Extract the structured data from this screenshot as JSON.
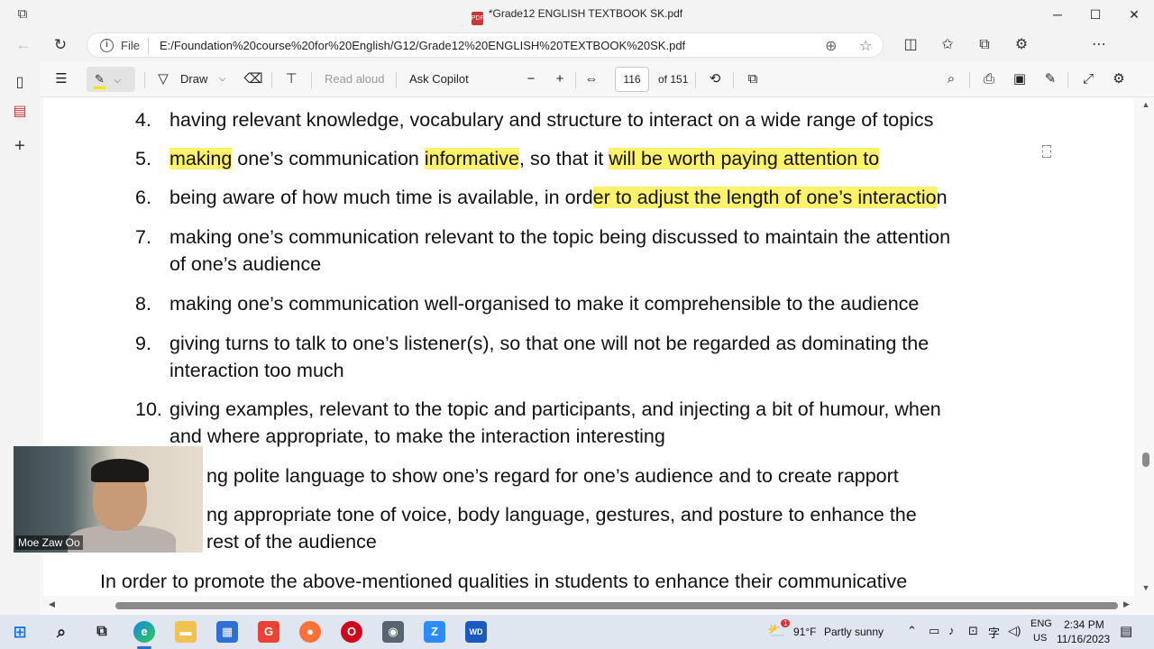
{
  "window": {
    "title": "*Grade12 ENGLISH TEXTBOOK SK.pdf",
    "file_badge": "PDF",
    "minimize": "─",
    "maximize": "☐",
    "close": "✕"
  },
  "address_bar": {
    "scheme_label": "File",
    "url": "E:/Foundation%20course%20for%20English/G12/Grade12%20ENGLISH%20TEXTBOOK%20SK.pdf"
  },
  "pdf_toolbar": {
    "draw_label": "Draw",
    "read_aloud_label": "Read aloud",
    "ask_copilot_label": "Ask Copilot",
    "zoom_out": "−",
    "zoom_in": "+",
    "page_current": "116",
    "page_total": "of 151"
  },
  "document": {
    "lines": [
      {
        "num": "4.",
        "segments": [
          {
            "text": "having relevant knowledge, vocabulary and structure to interact on a wide range of topics",
            "hl": false
          }
        ]
      },
      {
        "num": "5.",
        "segments": [
          {
            "text": "making",
            "hl": true
          },
          {
            "text": " one’s communication ",
            "hl": false
          },
          {
            "text": "informative",
            "hl": true
          },
          {
            "text": ", so that it ",
            "hl": false
          },
          {
            "text": "will be worth paying attention to",
            "hl": true
          }
        ]
      },
      {
        "num": "6.",
        "segments": [
          {
            "text": "being aware of how much time is available, in ord",
            "hl": false
          },
          {
            "text": "er to adjust the length of one’s interactio",
            "hl": true
          },
          {
            "text": "n",
            "hl": false
          }
        ]
      },
      {
        "num": "7.",
        "segments": [
          {
            "text": "making one’s communication relevant to the topic being discussed to maintain the attention",
            "hl": false
          }
        ],
        "cont": "of one’s audience"
      },
      {
        "num": "8.",
        "segments": [
          {
            "text": "making one’s communication well-organised to make it comprehensible to the audience",
            "hl": false
          }
        ]
      },
      {
        "num": "9.",
        "segments": [
          {
            "text": "giving turns to talk to one’s listener(s), so that one will not be regarded as dominating the",
            "hl": false
          }
        ],
        "cont": "interaction too much"
      },
      {
        "num": "10.",
        "segments": [
          {
            "text": "giving examples, relevant to the topic and participants, and injecting a bit of humour, when",
            "hl": false
          }
        ],
        "cont": "and where appropriate, to make the interaction interesting"
      },
      {
        "num": "",
        "segments": [
          {
            "text": "ng polite language to show one’s regard for one’s audience and to create rapport",
            "hl": false
          }
        ]
      },
      {
        "num": "",
        "segments": [
          {
            "text": "ng appropriate tone of voice, body language, gestures, and posture to enhance the",
            "hl": false
          }
        ],
        "cont": "rest of the audience"
      }
    ],
    "paragraph": "In order to promote the above-mentioned qualities in students to enhance their communicative"
  },
  "webcam": {
    "name": "Moe Zaw Oo"
  },
  "taskbar": {
    "weather_temp": "91°F",
    "weather_desc": "Partly sunny",
    "lang_top": "ENG",
    "lang_bottom": "US",
    "time": "2:34 PM",
    "date": "11/16/2023",
    "weather_badge": "1"
  },
  "colors": {
    "highlight": "#fff26b",
    "pdf_red": "#d13438",
    "scrollbar": "#8a8a8a"
  },
  "icons": [
    "edge-workspaces-icon",
    "back-icon",
    "refresh-icon",
    "info-icon",
    "zoom-icon",
    "star-icon",
    "split-screen-icon",
    "favorites-icon",
    "collections-icon",
    "extensions-icon",
    "more-icon",
    "copilot-icon",
    "tab-actions-icon",
    "pdf-tab-icon",
    "new-tab-icon",
    "contents-icon",
    "highlight-icon",
    "draw-icon",
    "erase-icon",
    "text-icon",
    "fit-icon",
    "rotate-icon",
    "page-view-icon",
    "search-icon",
    "print-icon",
    "save-icon",
    "save-as-icon",
    "fullscreen-icon",
    "settings-icon"
  ]
}
